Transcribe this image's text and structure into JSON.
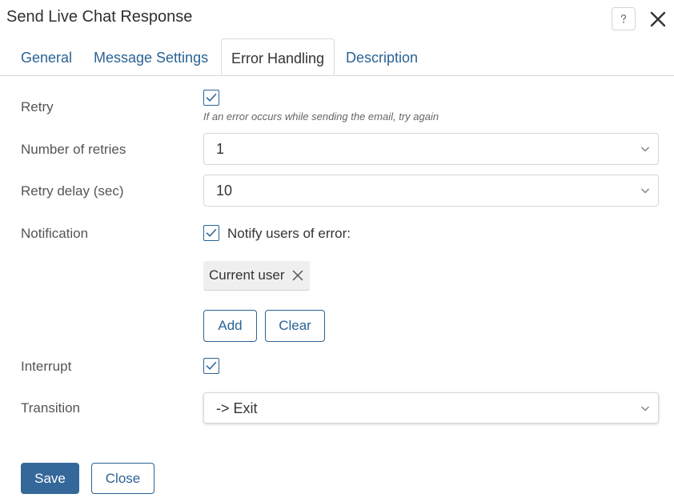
{
  "dialog": {
    "title": "Send Live Chat Response"
  },
  "tabs": [
    {
      "label": "General",
      "active": false
    },
    {
      "label": "Message Settings",
      "active": false
    },
    {
      "label": "Error Handling",
      "active": true
    },
    {
      "label": "Description",
      "active": false
    }
  ],
  "icons": {
    "help": "help-icon",
    "close": "close-icon",
    "check": "check-icon",
    "chevron": "chevron-down-icon",
    "remove": "remove-icon"
  },
  "form": {
    "retry": {
      "label": "Retry",
      "checked": true,
      "hint": "If an error occurs while sending the email, try again"
    },
    "number_of_retries": {
      "label": "Number of retries",
      "value": "1"
    },
    "retry_delay": {
      "label": "Retry delay (sec)",
      "value": "10"
    },
    "notification": {
      "label": "Notification",
      "checked": true,
      "checkbox_label": "Notify users of error:",
      "chips": [
        "Current user"
      ],
      "add_label": "Add",
      "clear_label": "Clear"
    },
    "interrupt": {
      "label": "Interrupt",
      "checked": true
    },
    "transition": {
      "label": "Transition",
      "value": "-> Exit"
    }
  },
  "footer": {
    "save_label": "Save",
    "close_label": "Close"
  },
  "colors": {
    "accent": "#2a6395",
    "primary_button": "#35689a",
    "border": "#d6d6d6",
    "chip_bg": "#efefef"
  }
}
